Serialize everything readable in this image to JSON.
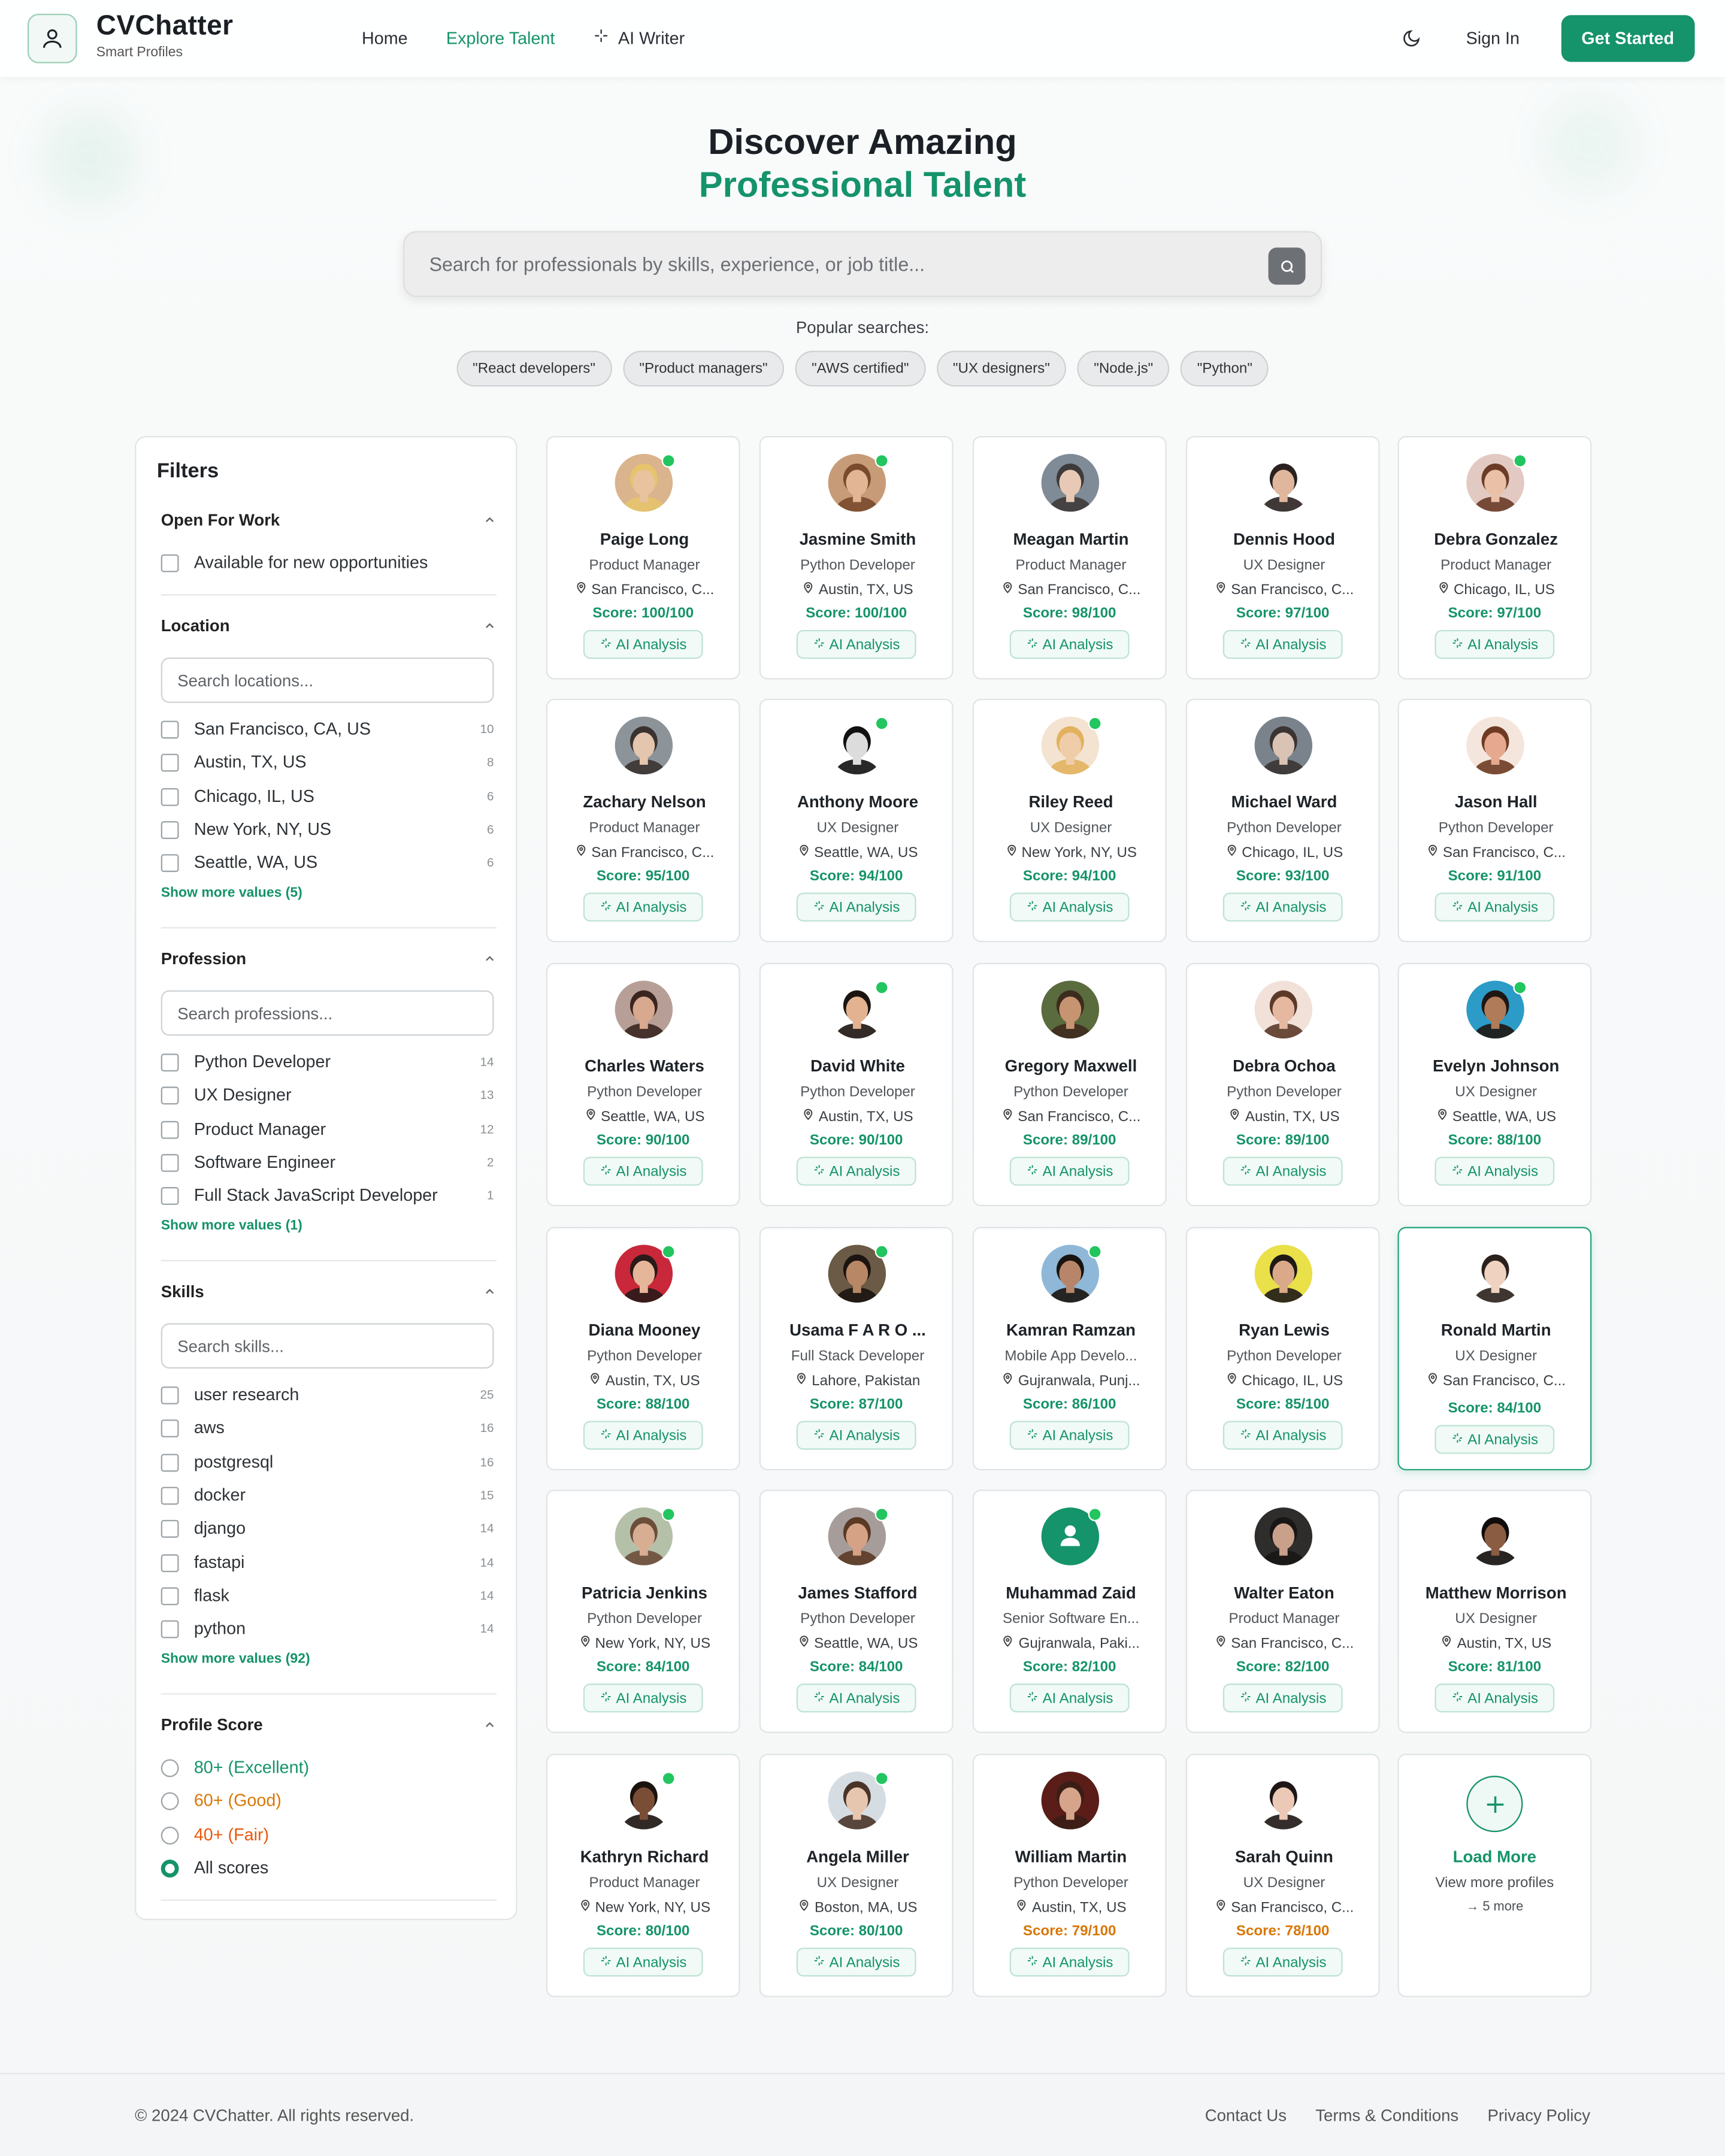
{
  "header": {
    "brand": "CVChatter",
    "tagline": "Smart Profiles",
    "nav": [
      "Home",
      "Explore Talent",
      "AI Writer"
    ],
    "signin": "Sign In",
    "cta": "Get Started",
    "accent": "#15936a"
  },
  "hero": {
    "title_line1": "Discover Amazing",
    "title_line2": "Professional Talent",
    "search_placeholder": "Search for professionals by skills, experience, or job title...",
    "popular_label": "Popular searches:",
    "chips": [
      "\"React developers\"",
      "\"Product managers\"",
      "\"AWS certified\"",
      "\"UX designers\"",
      "\"Node.js\"",
      "\"Python\""
    ]
  },
  "filters": {
    "title": "Filters",
    "open_for_work": {
      "label": "Open For Work",
      "option": "Available for new opportunities"
    },
    "location": {
      "label": "Location",
      "placeholder": "Search locations...",
      "options": [
        {
          "name": "San Francisco, CA, US",
          "count": "10"
        },
        {
          "name": "Austin, TX, US",
          "count": "8"
        },
        {
          "name": "Chicago, IL, US",
          "count": "6"
        },
        {
          "name": "New York, NY, US",
          "count": "6"
        },
        {
          "name": "Seattle, WA, US",
          "count": "6"
        }
      ],
      "show_more": "Show more values (5)"
    },
    "profession": {
      "label": "Profession",
      "placeholder": "Search professions...",
      "options": [
        {
          "name": "Python Developer",
          "count": "14"
        },
        {
          "name": "UX Designer",
          "count": "13"
        },
        {
          "name": "Product Manager",
          "count": "12"
        },
        {
          "name": "Software Engineer",
          "count": "2"
        },
        {
          "name": "Full Stack JavaScript Developer",
          "count": "1"
        }
      ],
      "show_more": "Show more values (1)"
    },
    "skills": {
      "label": "Skills",
      "placeholder": "Search skills...",
      "options": [
        {
          "name": "user research",
          "count": "25"
        },
        {
          "name": "aws",
          "count": "16"
        },
        {
          "name": "postgresql",
          "count": "16"
        },
        {
          "name": "docker",
          "count": "15"
        },
        {
          "name": "django",
          "count": "14"
        },
        {
          "name": "fastapi",
          "count": "14"
        },
        {
          "name": "flask",
          "count": "14"
        },
        {
          "name": "python",
          "count": "14"
        }
      ],
      "show_more": "Show more values (92)"
    },
    "profile_score": {
      "label": "Profile Score",
      "options": [
        {
          "name": "80+ (Excellent)",
          "color": "#15936a",
          "selected": false
        },
        {
          "name": "60+ (Good)",
          "color": "#d97706",
          "selected": false
        },
        {
          "name": "40+ (Fair)",
          "color": "#ea580c",
          "selected": false
        },
        {
          "name": "All scores",
          "color": "#2d3236",
          "selected": true
        }
      ]
    }
  },
  "profiles": [
    {
      "name": "Paige Long",
      "role": "Product Manager",
      "location": "San Francisco, C...",
      "score": "Score: 100/100",
      "online": true,
      "skin": "#e8c39e",
      "hair": "#e6c36d",
      "bg": "#d9b48c"
    },
    {
      "name": "Jasmine Smith",
      "role": "Python Developer",
      "location": "Austin, TX, US",
      "score": "Score: 100/100",
      "online": true,
      "skin": "#e2b594",
      "hair": "#7a4a2c",
      "bg": "#c89b78"
    },
    {
      "name": "Meagan Martin",
      "role": "Product Manager",
      "location": "San Francisco, C...",
      "score": "Score: 98/100",
      "online": false,
      "skin": "#e7c9b5",
      "hair": "#3e3a3a",
      "bg": "#7f8b96"
    },
    {
      "name": "Dennis Hood",
      "role": "UX Designer",
      "location": "San Francisco, C...",
      "score": "Score: 97/100",
      "online": false,
      "skin": "#e0b79c",
      "hair": "#2a2220",
      "bg": "#ffffff"
    },
    {
      "name": "Debra Gonzalez",
      "role": "Product Manager",
      "location": "Chicago, IL, US",
      "score": "Score: 97/100",
      "online": true,
      "skin": "#eac0a6",
      "hair": "#6b3b28",
      "bg": "#e2c9c1"
    },
    {
      "name": "Zachary Nelson",
      "role": "Product Manager",
      "location": "San Francisco, C...",
      "score": "Score: 95/100",
      "online": false,
      "skin": "#e4c5ae",
      "hair": "#3a3230",
      "bg": "#8c949a"
    },
    {
      "name": "Anthony Moore",
      "role": "UX Designer",
      "location": "Seattle, WA, US",
      "score": "Score: 94/100",
      "online": true,
      "skin": "#dcdcdc",
      "hair": "#111111",
      "bg": "#ffffff"
    },
    {
      "name": "Riley Reed",
      "role": "UX Designer",
      "location": "New York, NY, US",
      "score": "Score: 94/100",
      "online": true,
      "skin": "#f0cda9",
      "hair": "#e2b15e",
      "bg": "#f3e3d0"
    },
    {
      "name": "Michael Ward",
      "role": "Python Developer",
      "location": "Chicago, IL, US",
      "score": "Score: 93/100",
      "online": false,
      "skin": "#d9c3b4",
      "hair": "#3a3432",
      "bg": "#7a838b"
    },
    {
      "name": "Jason Hall",
      "role": "Python Developer",
      "location": "San Francisco, C...",
      "score": "Score: 91/100",
      "online": false,
      "skin": "#e6a98f",
      "hair": "#6e3b22",
      "bg": "#f4e6dc"
    },
    {
      "name": "Charles Waters",
      "role": "Python Developer",
      "location": "Seattle, WA, US",
      "score": "Score: 90/100",
      "online": false,
      "skin": "#d8a88f",
      "hair": "#3b2520",
      "bg": "#b79f98"
    },
    {
      "name": "David White",
      "role": "Python Developer",
      "location": "Austin, TX, US",
      "score": "Score: 90/100",
      "online": true,
      "skin": "#e3b291",
      "hair": "#1c1410",
      "bg": "#ffffff"
    },
    {
      "name": "Gregory Maxwell",
      "role": "Python Developer",
      "location": "San Francisco, C...",
      "score": "Score: 89/100",
      "online": false,
      "skin": "#c79472",
      "hair": "#3d2b1d",
      "bg": "#5a6b3e"
    },
    {
      "name": "Debra Ochoa",
      "role": "Python Developer",
      "location": "Austin, TX, US",
      "score": "Score: 89/100",
      "online": false,
      "skin": "#e6b8a0",
      "hair": "#5b3a2a",
      "bg": "#f1e1d8"
    },
    {
      "name": "Evelyn Johnson",
      "role": "UX Designer",
      "location": "Seattle, WA, US",
      "score": "Score: 88/100",
      "online": true,
      "skin": "#b07b58",
      "hair": "#1e1612",
      "bg": "#2c9bc7"
    },
    {
      "name": "Diana Mooney",
      "role": "Python Developer",
      "location": "Austin, TX, US",
      "score": "Score: 88/100",
      "online": true,
      "skin": "#e6b69b",
      "hair": "#2a1a18",
      "bg": "#c8283a"
    },
    {
      "name": "Usama F A R O ...",
      "role": "Full Stack Developer",
      "location": "Lahore, Pakistan",
      "score": "Score: 87/100",
      "online": true,
      "skin": "#b88866",
      "hair": "#1b1410",
      "bg": "#6b5a45"
    },
    {
      "name": "Kamran Ramzan",
      "role": "Mobile App Develo...",
      "location": "Gujranwala, Punj...",
      "score": "Score: 86/100",
      "online": true,
      "skin": "#b7866a",
      "hair": "#1a1410",
      "bg": "#8fb8d8"
    },
    {
      "name": "Ryan Lewis",
      "role": "Python Developer",
      "location": "Chicago, IL, US",
      "score": "Score: 85/100",
      "online": false,
      "skin": "#d9a98a",
      "hair": "#1f1a16",
      "bg": "#e9e04a"
    },
    {
      "name": "Ronald Martin",
      "role": "UX Designer",
      "location": "San Francisco, C...",
      "score": "Score: 84/100",
      "online": false,
      "skin": "#efd2bf",
      "hair": "#2a201c",
      "bg": "#ffffff"
    },
    {
      "name": "Patricia Jenkins",
      "role": "Python Developer",
      "location": "New York, NY, US",
      "score": "Score: 84/100",
      "online": true,
      "skin": "#d8ae93",
      "hair": "#6b4e3a",
      "bg": "#b5c0a9"
    },
    {
      "name": "James Stafford",
      "role": "Python Developer",
      "location": "Seattle, WA, US",
      "score": "Score: 84/100",
      "online": true,
      "skin": "#d6a286",
      "hair": "#5a3a24",
      "bg": "#a69d9a"
    },
    {
      "name": "Muhammad Zaid",
      "role": "Senior Software En...",
      "location": "Gujranwala, Paki...",
      "score": "Score: 82/100",
      "online": true,
      "skin": "#ffffff",
      "hair": "#15936a",
      "bg": "#15936a",
      "placeholder": true
    },
    {
      "name": "Walter Eaton",
      "role": "Product Manager",
      "location": "San Francisco, C...",
      "score": "Score: 82/100",
      "online": false,
      "skin": "#c9a08a",
      "hair": "#1a1616",
      "bg": "#2f2c2c"
    },
    {
      "name": "Matthew Morrison",
      "role": "UX Designer",
      "location": "Austin, TX, US",
      "score": "Score: 81/100",
      "online": false,
      "skin": "#8a5c42",
      "hair": "#0f0c0a",
      "bg": "#ffffff"
    },
    {
      "name": "Kathryn Richard",
      "role": "Product Manager",
      "location": "New York, NY, US",
      "score": "Score: 80/100",
      "online": true,
      "skin": "#7a4e36",
      "hair": "#1a120d",
      "bg": "#ffffff"
    },
    {
      "name": "Angela Miller",
      "role": "UX Designer",
      "location": "Boston, MA, US",
      "score": "Score: 80/100",
      "online": true,
      "skin": "#e7c6b0",
      "hair": "#4a3428",
      "bg": "#d5dde3"
    },
    {
      "name": "William Martin",
      "role": "Python Developer",
      "location": "Austin, TX, US",
      "score": "Score: 79/100",
      "online": false,
      "skin": "#d6a48a",
      "hair": "#3a1e16",
      "bg": "#5a1d18",
      "orange": true
    },
    {
      "name": "Sarah Quinn",
      "role": "UX Designer",
      "location": "San Francisco, C...",
      "score": "Score: 78/100",
      "online": false,
      "skin": "#ecc9b6",
      "hair": "#1e1614",
      "bg": "#ffffff",
      "orange": true
    }
  ],
  "ai_label": "AI Analysis",
  "load_more": {
    "title": "Load More",
    "subtitle": "View more profiles",
    "more": "5 more"
  },
  "footer": {
    "copyright": "© 2024 CVChatter. All rights reserved.",
    "links": [
      "Contact Us",
      "Terms & Conditions",
      "Privacy Policy"
    ]
  }
}
